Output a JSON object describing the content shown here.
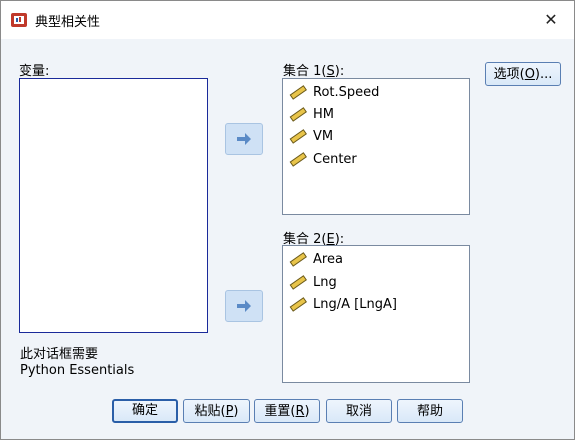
{
  "window": {
    "title": "典型相关性",
    "close_glyph": "✕"
  },
  "variables": {
    "label": "变量:"
  },
  "set1": {
    "label_prefix": "集合 1(",
    "label_key": "S",
    "label_suffix": "):",
    "items": [
      "Rot.Speed",
      "HM",
      "VM",
      "Center"
    ]
  },
  "set2": {
    "label_prefix": "集合 2(",
    "label_key": "E",
    "label_suffix": "):",
    "items": [
      "Area",
      "Lng",
      "Lng/A [LngA]"
    ]
  },
  "options_button": {
    "prefix": "选项(",
    "key": "O",
    "suffix": ")..."
  },
  "note": {
    "line1": "此对话框需要",
    "line2": "Python Essentials"
  },
  "buttons": {
    "ok": "确定",
    "paste": {
      "prefix": "粘贴(",
      "key": "P",
      "suffix": ")"
    },
    "reset": {
      "prefix": "重置(",
      "key": "R",
      "suffix": ")"
    },
    "cancel": "取消",
    "help": "帮助"
  },
  "icons": {
    "variable": "ruler-scale-icon",
    "arrow": "right-arrow-icon",
    "app": "spss-app-icon"
  },
  "colors": {
    "accent": "#2a5ea8",
    "arrow_bg": "#cfe1f5",
    "list_border": "#1a2a9a"
  }
}
